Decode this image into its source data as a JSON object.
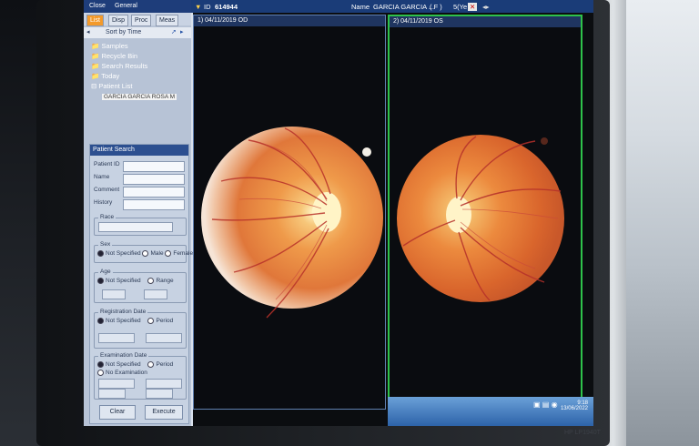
{
  "app": {
    "menu": [
      "Close",
      "General"
    ],
    "tabs": [
      "List",
      "Disp",
      "Proc",
      "Meas"
    ],
    "sort_label": "Sort by Time",
    "tree": [
      "Samples",
      "Recycle Bin",
      "Search Results",
      "Today",
      "Patient List"
    ],
    "selected_patient": "GARCIA GARCIA ROSA M"
  },
  "search": {
    "title": "Patient Search",
    "fields": [
      "Patient ID",
      "Name",
      "Comment",
      "History"
    ],
    "race_label": "Race",
    "sex": {
      "label": "Sex",
      "options": [
        "Not Specified",
        "Male",
        "Female"
      ]
    },
    "age": {
      "label": "Age",
      "options": [
        "Not Specified",
        "Range"
      ]
    },
    "registration": {
      "label": "Registration Date",
      "options": [
        "Not Specified",
        "Period"
      ]
    },
    "examination": {
      "label": "Examination Date",
      "options": [
        "Not Specified",
        "Period",
        "No Examination"
      ]
    },
    "clear": "Clear",
    "execute": "Execute"
  },
  "header": {
    "id_label": "ID",
    "id_value": "614944",
    "name_label": "Name",
    "name_value": "GARCIA GARCIA ...",
    "sex_value": "( F )",
    "field3": "5(Ye"
  },
  "viewers": [
    {
      "label": "1) 04/11/2019 OD"
    },
    {
      "label": "2) 04/11/2019 OS"
    }
  ],
  "taskbar": {
    "time": "9:18",
    "date": "13/06/2022"
  },
  "brand": "HP LP1940T",
  "colors": {
    "title_bar": "#1a3c78",
    "active_tab": "#f39a2b",
    "selected_frame": "#2ec24a"
  }
}
